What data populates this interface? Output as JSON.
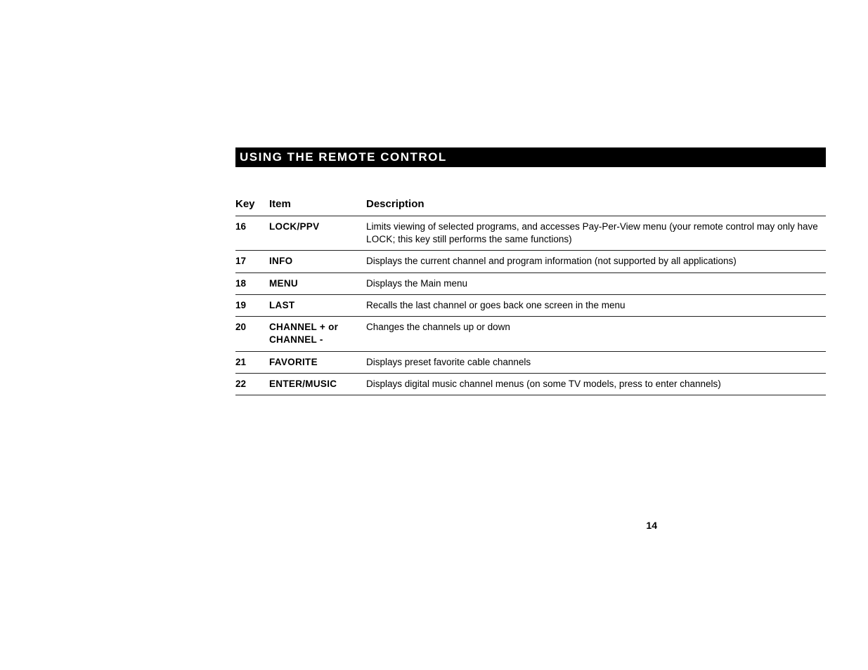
{
  "section_title": "USING THE REMOTE CONTROL",
  "headers": {
    "key": "Key",
    "item": "Item",
    "description": "Description"
  },
  "rows": [
    {
      "key": "16",
      "item": "LOCK/PPV",
      "desc_pre": "Limits viewing of selected programs, and accesses Pay-Per-View menu (your remote control may only have ",
      "desc_sc": "LOCK",
      "desc_post": "; this key still performs the same functions)"
    },
    {
      "key": "17",
      "item": "INFO",
      "desc_pre": "Displays the current channel and program information (not supported by all applications)",
      "desc_sc": "",
      "desc_post": ""
    },
    {
      "key": "18",
      "item": "MENU",
      "desc_pre": "Displays the Main menu",
      "desc_sc": "",
      "desc_post": ""
    },
    {
      "key": "19",
      "item": "LAST",
      "desc_pre": "Recalls the last channel or goes back one screen in the menu",
      "desc_sc": "",
      "desc_post": ""
    },
    {
      "key": "20",
      "item": "CHANNEL + or CHANNEL -",
      "desc_pre": "Changes the channels up or down",
      "desc_sc": "",
      "desc_post": ""
    },
    {
      "key": "21",
      "item": "FAVORITE",
      "desc_pre": "Displays preset favorite cable channels",
      "desc_sc": "",
      "desc_post": ""
    },
    {
      "key": "22",
      "item": "ENTER/MUSIC",
      "desc_pre": "Displays digital music channel menus (on some TV models, press to enter channels)",
      "desc_sc": "",
      "desc_post": ""
    }
  ],
  "page_number": "14"
}
